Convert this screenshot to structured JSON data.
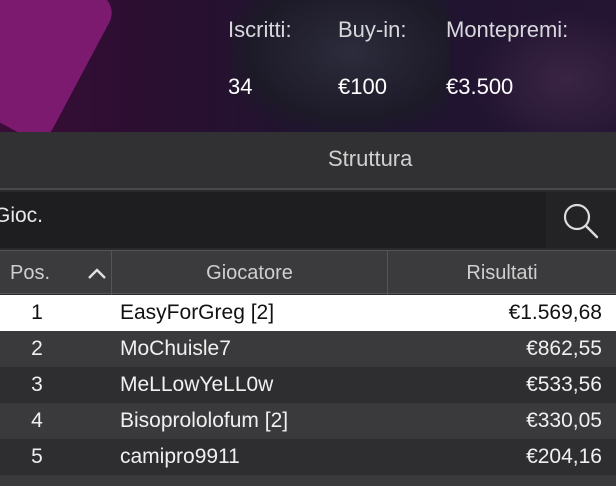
{
  "stats": {
    "labels": [
      "Iscritti:",
      "Buy-in:",
      "Montepremi:"
    ],
    "values": [
      "34",
      "€100",
      "€3.500"
    ]
  },
  "tabs": {
    "structure": "Struttura"
  },
  "search": {
    "value": "Gioc."
  },
  "table": {
    "headers": {
      "pos": "Pos.",
      "player": "Giocatore",
      "result": "Risultati"
    },
    "rows": [
      {
        "pos": "1",
        "player": "EasyForGreg [2]",
        "result": "€1.569,68"
      },
      {
        "pos": "2",
        "player": "MoChuisle7",
        "result": "€862,55"
      },
      {
        "pos": "3",
        "player": "MeLLowYeLL0w",
        "result": "€533,56"
      },
      {
        "pos": "4",
        "player": "Bisoprololofum [2]",
        "result": "€330,05"
      },
      {
        "pos": "5",
        "player": "camipro9911",
        "result": "€204,16"
      }
    ]
  },
  "icons": {
    "search": "search-icon",
    "sort": "chevron-up-icon"
  },
  "colors": {
    "selected_row": "#ffffff",
    "banner_accent": "#7b1a6e"
  }
}
